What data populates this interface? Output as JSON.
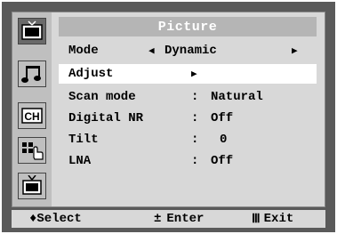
{
  "menu": {
    "title": "Picture",
    "rows": [
      {
        "label": "Mode",
        "value": "Dynamic"
      },
      {
        "label": "Adjust"
      },
      {
        "label": "Scan mode",
        "sep": ":",
        "value": "Natural"
      },
      {
        "label": "Digital NR",
        "sep": ":",
        "value": "Off"
      },
      {
        "label": "Tilt",
        "sep": ":",
        "value": "0"
      },
      {
        "label": "LNA",
        "sep": ":",
        "value": "Off"
      }
    ]
  },
  "sidebar": {
    "icons": [
      "input-icon",
      "picture-icon",
      "sound-icon",
      "channel-icon",
      "setup-icon",
      "input-tv-icon"
    ],
    "channel_label": "CH"
  },
  "help": {
    "select_symbol": "♦",
    "select": "Select",
    "enter_symbol": "±",
    "enter": "Enter",
    "exit_symbol": "Ⅲ",
    "exit": "Exit"
  },
  "colors": {
    "frame": "#5a5a5a",
    "menu_bg": "#d8d8d8",
    "title_bg": "#b5b5b5",
    "selected_bg": "#ffffff"
  }
}
